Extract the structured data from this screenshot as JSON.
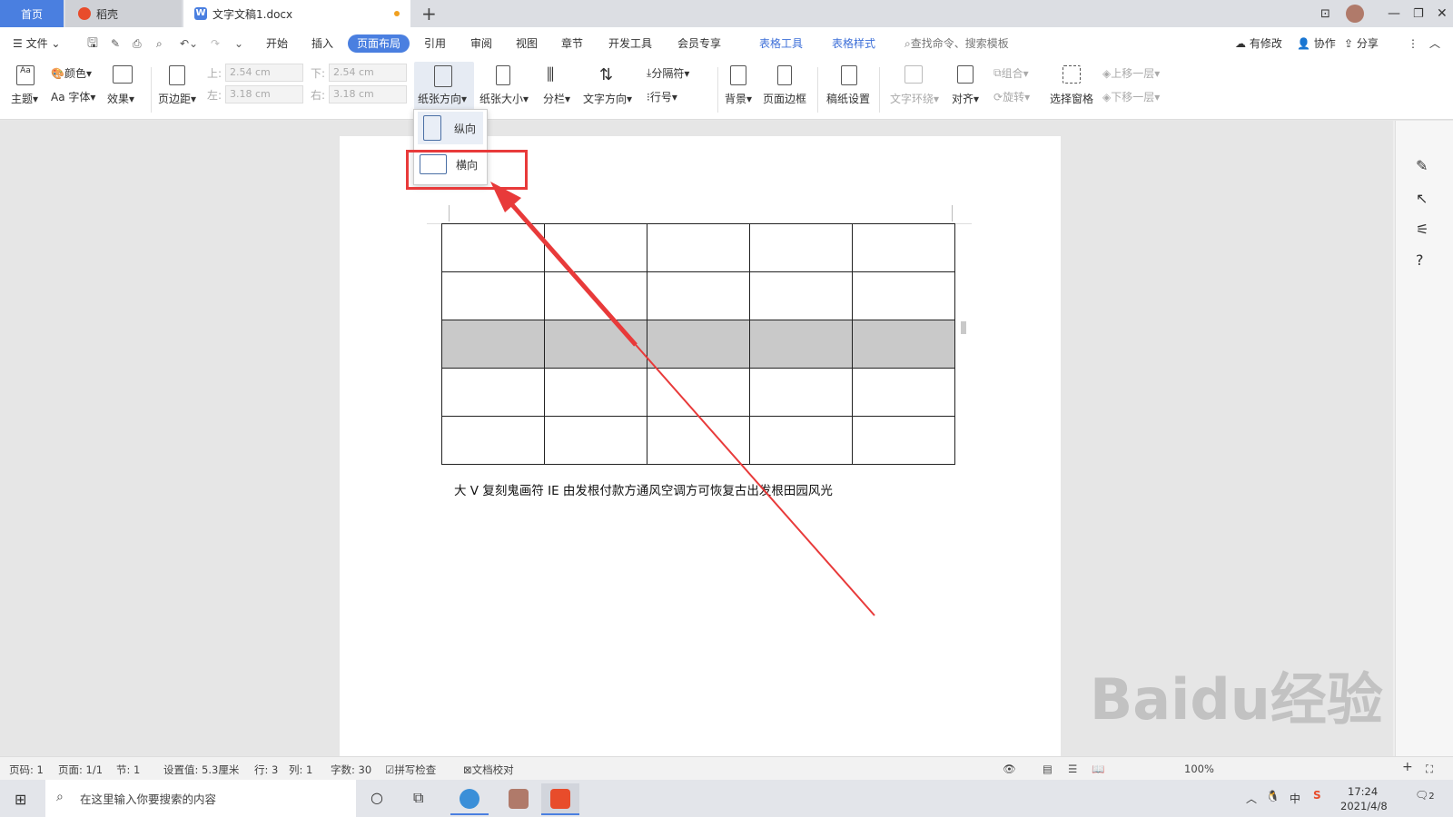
{
  "tabs": {
    "home": "首页",
    "daoke": "稻壳",
    "doc": "文字文稿1.docx",
    "new_tab": "+"
  },
  "menu": {
    "file": "文件",
    "items": [
      "开始",
      "插入",
      "页面布局",
      "引用",
      "审阅",
      "视图",
      "章节",
      "开发工具",
      "会员专享"
    ],
    "table_tools": "表格工具",
    "table_style": "表格样式",
    "search": "查找命令、搜索模板",
    "right": [
      "有修改",
      "协作",
      "分享"
    ]
  },
  "ribbon": {
    "theme": "主题",
    "color": "颜色",
    "font": "Aa 字体",
    "effect": "效果",
    "margin": "页边距",
    "top_label": "上:",
    "top_value": "2.54 cm",
    "left_label": "左:",
    "left_value": "3.18 cm",
    "bottom_label": "下:",
    "bottom_value": "2.54 cm",
    "right_label": "右:",
    "right_value": "3.18 cm",
    "orientation": "纸张方向",
    "size": "纸张大小",
    "columns": "分栏",
    "text_direction": "文字方向",
    "separator": "分隔符",
    "line_num": "行号",
    "background": "背景",
    "page_border": "页面边框",
    "manuscript": "稿纸设置",
    "wrap": "文字环绕",
    "align": "对齐",
    "group": "组合",
    "rotate": "旋转",
    "select_pane": "选择窗格",
    "bring_forward": "上移一层",
    "send_backward": "下移一层"
  },
  "dropdown": {
    "portrait": "纵向",
    "landscape": "横向"
  },
  "document": {
    "text": "大 V 复刻鬼画符 IE 由发根付款方通风空调方可恢复古出发根田园风光"
  },
  "status": {
    "page_code": "页码: 1",
    "pages": "页面: 1/1",
    "section": "节: 1",
    "setting": "设置值: 5.3厘米",
    "row": "行: 3",
    "col": "列: 1",
    "words": "字数: 30",
    "spell": "拼写检查",
    "proof": "文档校对",
    "zoom": "100%"
  },
  "taskbar": {
    "search_placeholder": "在这里输入你要搜索的内容",
    "time": "17:24",
    "date": "2021/4/8",
    "ime": "中",
    "notif": "2"
  },
  "watermark": "Baidu经验"
}
